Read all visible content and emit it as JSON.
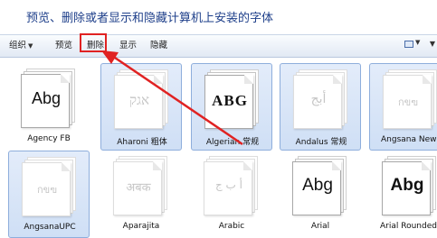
{
  "page_title": "预览、删除或者显示和隐藏计算机上安装的字体",
  "toolbar": {
    "organize": "组织",
    "preview": "预览",
    "delete": "删除",
    "show": "显示",
    "hide": "隐藏"
  },
  "colors": {
    "annotation": "#e02222",
    "selection": "#cfdff5",
    "title": "#1e3f8a"
  },
  "fonts": [
    {
      "name": "Agency FB",
      "sample": "Abg",
      "selected": false,
      "hidden": false
    },
    {
      "name": "Aharoni 粗体",
      "sample": "אגק",
      "selected": true,
      "hidden": true
    },
    {
      "name": "Algerian 常规",
      "sample": "ABG",
      "selected": true,
      "hidden": false
    },
    {
      "name": "Andalus 常规",
      "sample": "أبج",
      "selected": true,
      "hidden": true
    },
    {
      "name": "Angsana New",
      "sample": "กขฃ",
      "selected": true,
      "hidden": true
    },
    {
      "name": "AngsanaUPC",
      "sample": "กขฃ",
      "selected": true,
      "hidden": true
    },
    {
      "name": "Aparajita",
      "sample": "अबक",
      "selected": false,
      "hidden": true
    },
    {
      "name": "Arabic",
      "sample": "أ ب ج",
      "selected": false,
      "hidden": true
    },
    {
      "name": "Arial",
      "sample": "Abg",
      "selected": false,
      "hidden": false
    },
    {
      "name": "Arial Rounded",
      "sample": "Abg",
      "selected": false,
      "hidden": false
    }
  ]
}
